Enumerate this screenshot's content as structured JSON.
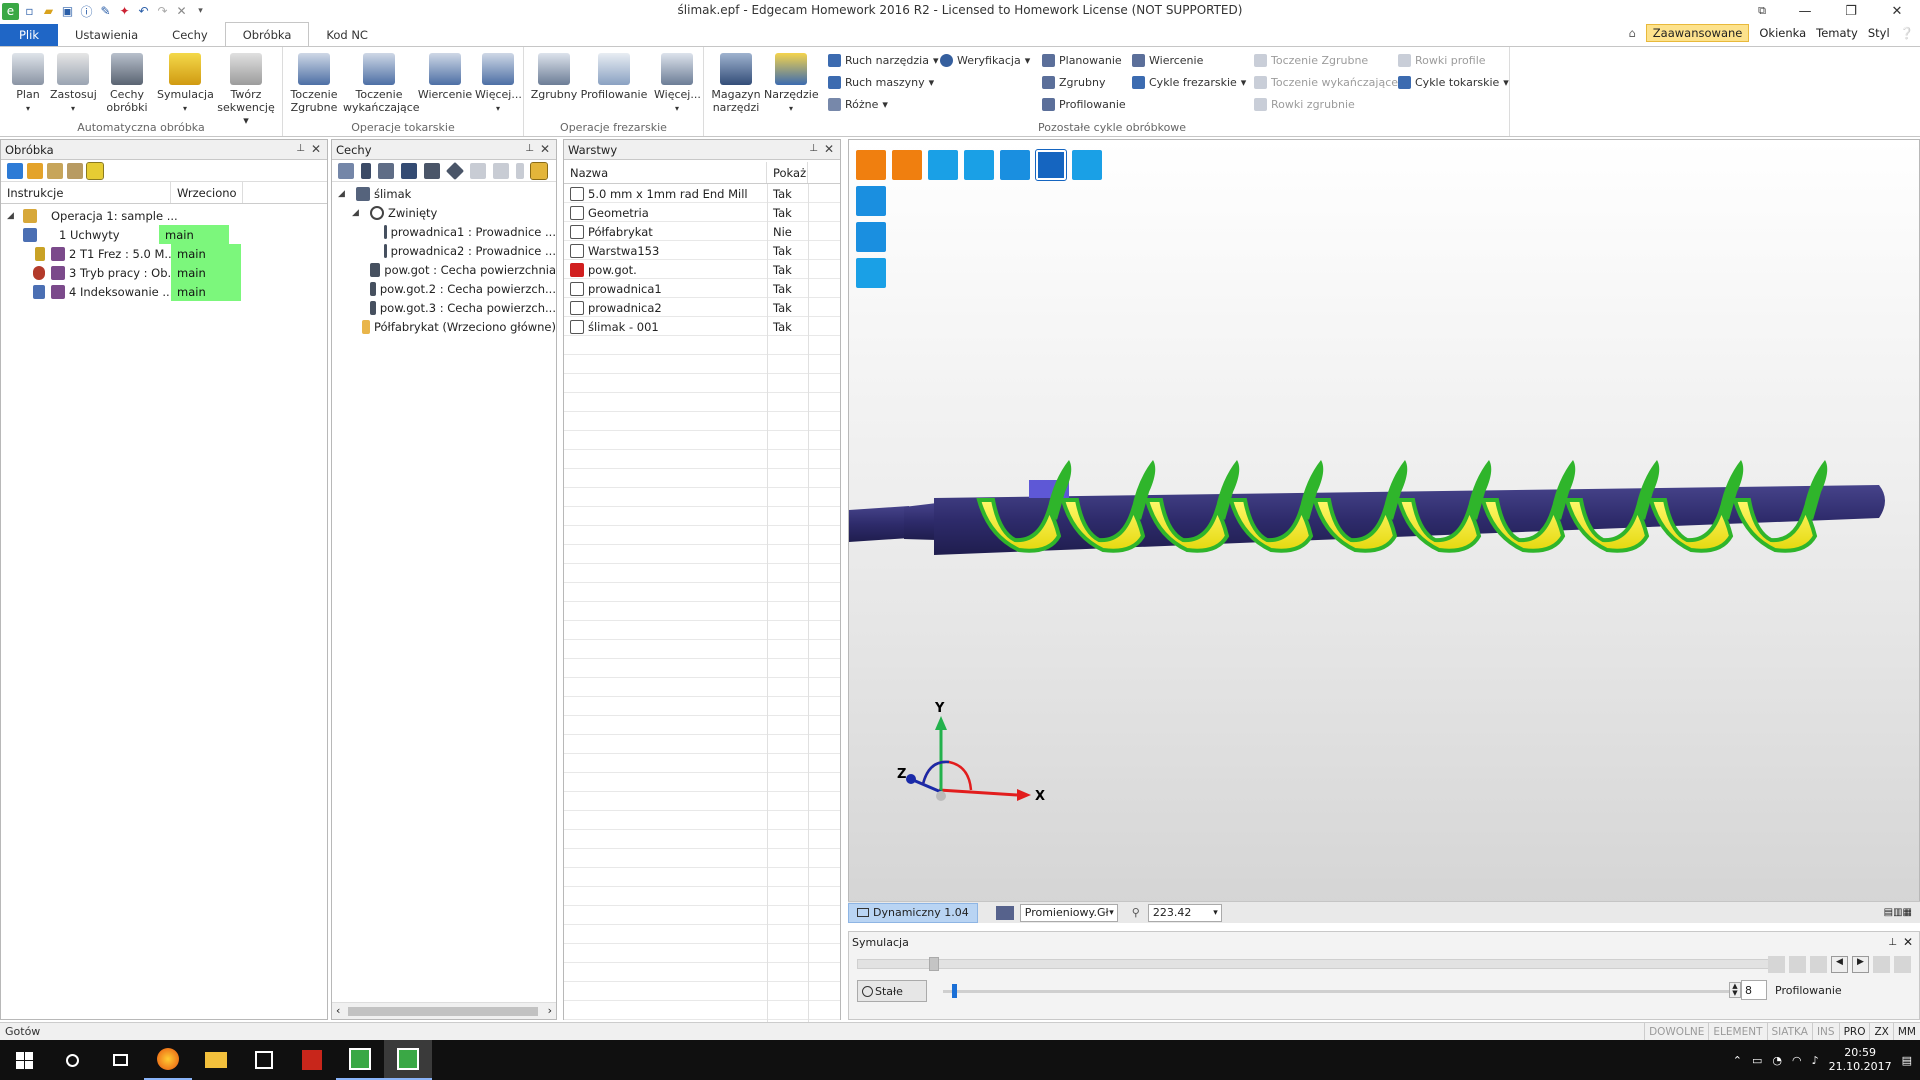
{
  "window": {
    "title": "ślimak.epf - Edgecam Homework 2016 R2  -  Licensed to Homework License (NOT SUPPORTED)"
  },
  "tabs": [
    {
      "label": "Plik"
    },
    {
      "label": "Ustawienia"
    },
    {
      "label": "Cechy"
    },
    {
      "label": "Obróbka"
    },
    {
      "label": "Kod NC"
    }
  ],
  "tabs_right": {
    "zaawansowane": "Zaawansowane",
    "okienka": "Okienka",
    "tematy": "Tematy",
    "styl": "Styl"
  },
  "ribbon": {
    "groups": [
      {
        "label": "Automatyczna obróbka"
      },
      {
        "label": "Operacje tokarskie"
      },
      {
        "label": "Operacje frezarskie"
      },
      {
        "label": "Pozostałe cykle obróbkowe"
      }
    ],
    "buttons": {
      "plan": "Plan",
      "zastosuj": "Zastosuj",
      "cechy_obrobki_1": "Cechy",
      "cechy_obrobki_2": "obróbki",
      "symulacja": "Symulacja",
      "tworz_1": "Twórz",
      "tworz_2": "sekwencję",
      "toczenie_zgr_1": "Toczenie",
      "toczenie_zgr_2": "Zgrubne",
      "toczenie_wyk_1": "Toczenie",
      "toczenie_wyk_2": "wykańczające",
      "wiercenie": "Wiercenie",
      "wiecej1": "Więcej...",
      "zgrubny": "Zgrubny",
      "profilowanie": "Profilowanie",
      "wiecej2": "Więcej...",
      "magazyn_1": "Magazyn",
      "magazyn_2": "narzędzi",
      "narzedzie": "Narzędzie",
      "ruch_narzedzia": "Ruch narzędzia",
      "weryfikacja": "Weryfikacja",
      "ruch_maszyny": "Ruch maszyny",
      "rozne": "Różne",
      "planowanie": "Planowanie",
      "zgrubny2": "Zgrubny",
      "profilowanie2": "Profilowanie",
      "wiercenie2": "Wiercenie",
      "cykle_frez": "Cykle frezarskie",
      "toczenie_zgrubne_s": "Toczenie Zgrubne",
      "toczenie_wyk_s": "Toczenie wykańczające",
      "rowki_zgrubnie": "Rowki zgrubnie",
      "rowki_profile": "Rowki profile",
      "cykle_tok": "Cykle tokarskie"
    }
  },
  "obrobka_panel": {
    "title": "Obróbka",
    "columns": [
      "Instrukcje",
      "Wrzeciono"
    ],
    "root": "Operacja 1: sample ...",
    "rows": [
      {
        "label": "1 Uchwyty",
        "spindle": "main"
      },
      {
        "label": "2 T1 Frez : 5.0 M...",
        "spindle": "main"
      },
      {
        "label": "3 Tryb pracy : Ob...",
        "spindle": "main"
      },
      {
        "label": "4 Indeksowanie ...",
        "spindle": "main"
      }
    ]
  },
  "cechy_panel": {
    "title": "Cechy",
    "root": "ślimak",
    "group": "Zwinięty",
    "group_items": [
      "prowadnica1 :  Prowadnice ...",
      "prowadnica2 :  Prowadnice ..."
    ],
    "items": [
      "pow.got :  Cecha powierzchnia",
      "pow.got.2 :  Cecha powierzch...",
      "pow.got.3 :  Cecha powierzch..."
    ],
    "stock": "Półfabrykat (Wrzeciono główne)"
  },
  "warstwy_panel": {
    "title": "Warstwy",
    "columns": [
      "Nazwa",
      "Pokaż"
    ],
    "rows": [
      {
        "name": "5.0 mm x 1mm rad End Mill",
        "show": "Tak"
      },
      {
        "name": "Geometria",
        "show": "Tak"
      },
      {
        "name": "Półfabrykat",
        "show": "Nie"
      },
      {
        "name": "Warstwa153",
        "show": "Tak"
      },
      {
        "name": "pow.got.",
        "show": "Tak"
      },
      {
        "name": "prowadnica1",
        "show": "Tak"
      },
      {
        "name": "prowadnica2",
        "show": "Tak"
      },
      {
        "name": "ślimak - 001",
        "show": "Tak"
      }
    ]
  },
  "viewport": {
    "axes": {
      "x": "X",
      "y": "Y",
      "z": "Z"
    },
    "status": {
      "mode": "Dynamiczny 1.04",
      "shading": "Promieniowy.Gł",
      "value": "223.42"
    }
  },
  "simulation": {
    "title": "Symulacja",
    "stale": "Stałe",
    "step": "8",
    "profile": "Profilowanie"
  },
  "statusbar": {
    "text": "Gotów",
    "modes": [
      "DOWOLNE",
      "ELEMENT",
      "SIATKA",
      "INS",
      "PRO",
      "ZX",
      "MM"
    ]
  },
  "taskbar": {
    "time": "20:59",
    "date": "21.10.2017"
  },
  "colors": {
    "accent": "#1f66c6",
    "spindle_bg": "#7cf77c",
    "screw_shaft": "#2e2b6b",
    "screw_flight": "#f3ef1c",
    "screw_edge": "#2fb52b",
    "toolbar_orange": "#f07f0f",
    "toolbar_blue": "#1a8fe0"
  }
}
